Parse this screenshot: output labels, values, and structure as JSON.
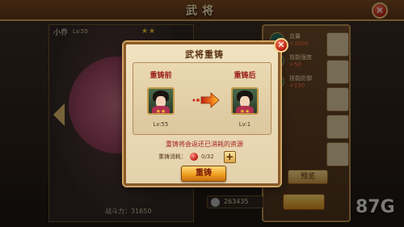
{
  "header": {
    "title": "武将",
    "close_symbol": "✕"
  },
  "hero": {
    "name": "小乔",
    "level": "Lv:55",
    "stars": "★★",
    "power_label": "战斗力：31650"
  },
  "stats": [
    {
      "name": "血量",
      "value": "+3000"
    },
    {
      "name": "技能强度",
      "value": "+50"
    },
    {
      "name": "技能防御",
      "value": "+150"
    }
  ],
  "background": {
    "preview_label": "预览",
    "resource_amount": "263435"
  },
  "watermark": "87G",
  "dialog": {
    "title": "武将重铸",
    "close_symbol": "✕",
    "before": {
      "label": "重铸前",
      "stars": "★★",
      "level": "Lv:55"
    },
    "after": {
      "label": "重铸后",
      "stars": "★★",
      "level": "Lv:1"
    },
    "info": "重铸将会返还已消耗的资源",
    "cost": {
      "label": "重铸消耗：",
      "count": "0/32",
      "plus_symbol": "+"
    },
    "confirm_label": "重铸"
  },
  "colors": {
    "accent": "#f0a020",
    "warning_text": "#a4201a",
    "stat_bonus": "#ff6a3a",
    "frame": "#8a5a2a"
  }
}
